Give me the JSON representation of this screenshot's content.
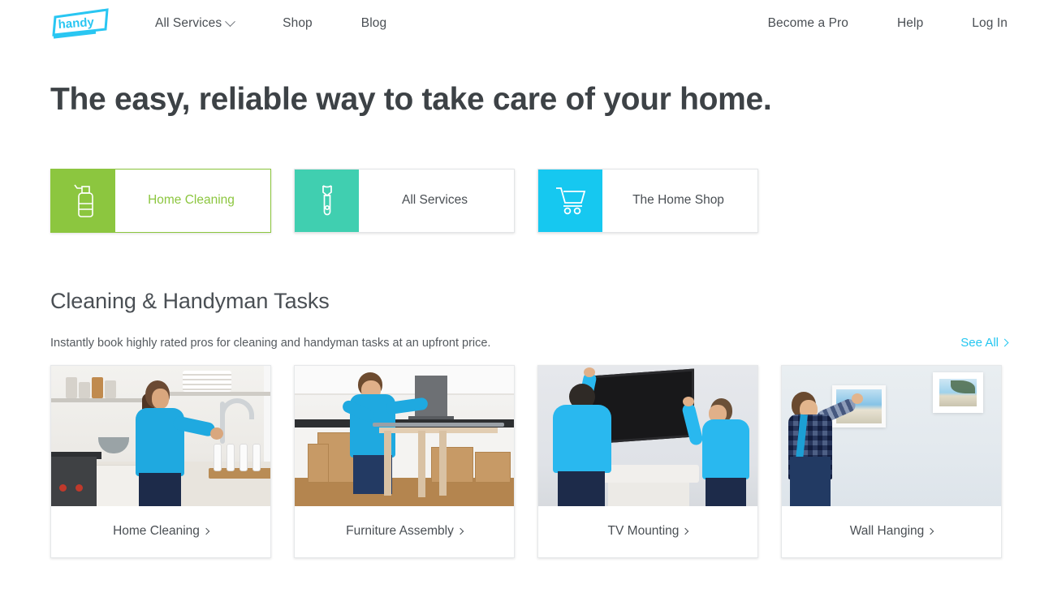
{
  "brand": {
    "logo_text": "handy",
    "logo_color": "#29c6f2"
  },
  "header": {
    "nav_left": [
      {
        "label": "All Services",
        "icon": "chevron-down-icon",
        "has_chevron": true
      },
      {
        "label": "Shop",
        "has_chevron": false
      },
      {
        "label": "Blog",
        "has_chevron": false
      }
    ],
    "nav_right": [
      {
        "label": "Become a Pro"
      },
      {
        "label": "Help"
      },
      {
        "label": "Log In"
      }
    ]
  },
  "hero": {
    "headline": "The easy, reliable way to take care of your home."
  },
  "service_cards": [
    {
      "label": "Home Cleaning",
      "icon": "spray-bottle-icon",
      "color": "#8cc63f",
      "active": true
    },
    {
      "label": "All Services",
      "icon": "wrench-icon",
      "color": "#40cfb0",
      "active": false
    },
    {
      "label": "The Home Shop",
      "icon": "shopping-cart-icon",
      "color": "#16c8f0",
      "active": false
    }
  ],
  "section": {
    "title": "Cleaning & Handyman Tasks",
    "subtitle": "Instantly book highly rated pros for cleaning and handyman tasks at an upfront price.",
    "see_all_label": "See All",
    "see_all_color": "#24c6f0"
  },
  "task_cards": [
    {
      "label": "Home Cleaning",
      "image_alt": "woman-washing-dishes-in-kitchen"
    },
    {
      "label": "Furniture Assembly",
      "image_alt": "man-assembling-table-with-boxes"
    },
    {
      "label": "TV Mounting",
      "image_alt": "two-men-mounting-flat-screen-tv"
    },
    {
      "label": "Wall Hanging",
      "image_alt": "man-hanging-framed-picture-on-wall"
    }
  ]
}
